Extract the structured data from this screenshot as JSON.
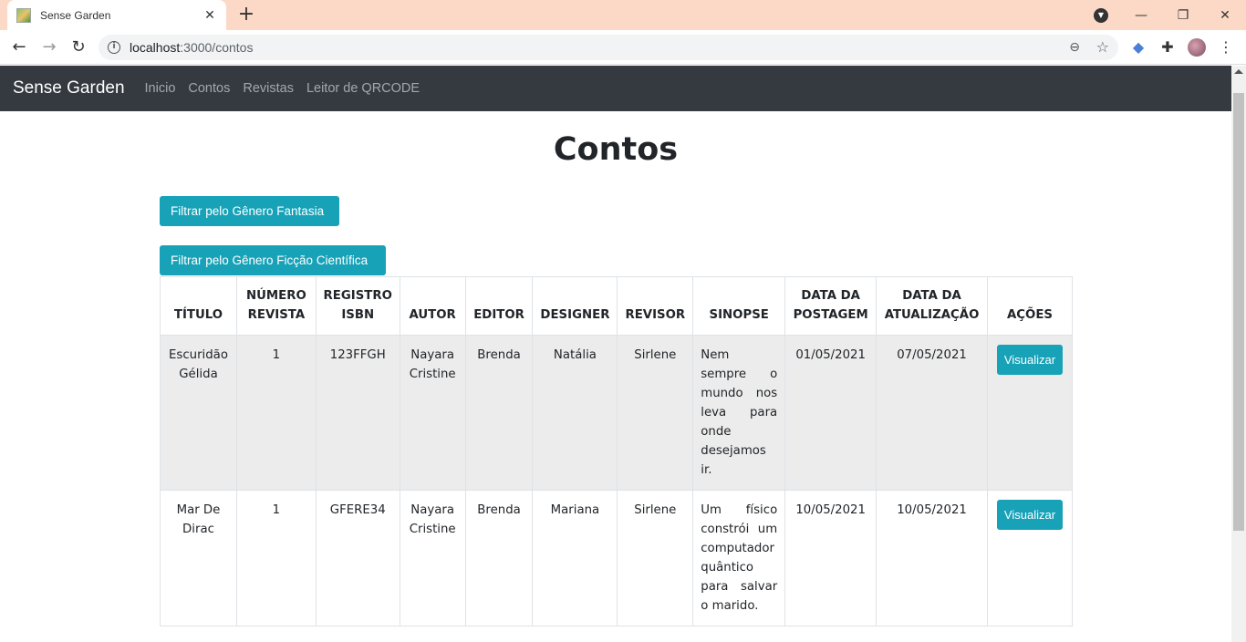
{
  "browser": {
    "tab_title": "Sense Garden",
    "url_host": "localhost",
    "url_path": ":3000/contos"
  },
  "navbar": {
    "brand": "Sense Garden",
    "links": [
      "Inicio",
      "Contos",
      "Revistas",
      "Leitor de QRCODE"
    ]
  },
  "page": {
    "title": "Contos",
    "filter_fantasia": "Filtrar pelo Gênero Fantasia",
    "filter_ficcao": "Filtrar pelo Gênero Ficção Científica"
  },
  "table": {
    "headers": {
      "titulo": "TÍTULO",
      "numero_revista": "NÚMERO REVISTA",
      "registro_isbn": "REGISTRO ISBN",
      "autor": "AUTOR",
      "editor": "EDITOR",
      "designer": "DESIGNER",
      "revisor": "REVISOR",
      "sinopse": "SINOPSE",
      "data_postagem": "DATA DA POSTAGEM",
      "data_atualizacao": "DATA DA ATUALIZAÇÃO",
      "acoes": "AÇÕES"
    },
    "rows": [
      {
        "titulo": "Escuridão Gélida",
        "numero_revista": "1",
        "registro_isbn": "123FFGH",
        "autor": "Nayara Cristine",
        "editor": "Brenda",
        "designer": "Natália",
        "revisor": "Sirlene",
        "sinopse": "Nem sempre o mundo nos leva para onde desejamos ir.",
        "data_postagem": "01/05/2021",
        "data_atualizacao": "07/05/2021",
        "action_label": "Visualizar"
      },
      {
        "titulo": "Mar De Dirac",
        "numero_revista": "1",
        "registro_isbn": "GFERE34",
        "autor": "Nayara Cristine",
        "editor": "Brenda",
        "designer": "Mariana",
        "revisor": "Sirlene",
        "sinopse": "Um físico constrói um computador quântico para salvar o marido.",
        "data_postagem": "10/05/2021",
        "data_atualizacao": "10/05/2021",
        "action_label": "Visualizar"
      }
    ]
  },
  "colors": {
    "navbar_bg": "#343a40",
    "button_info": "#17a2b8",
    "tabbar_bg": "#fbd9c6"
  }
}
